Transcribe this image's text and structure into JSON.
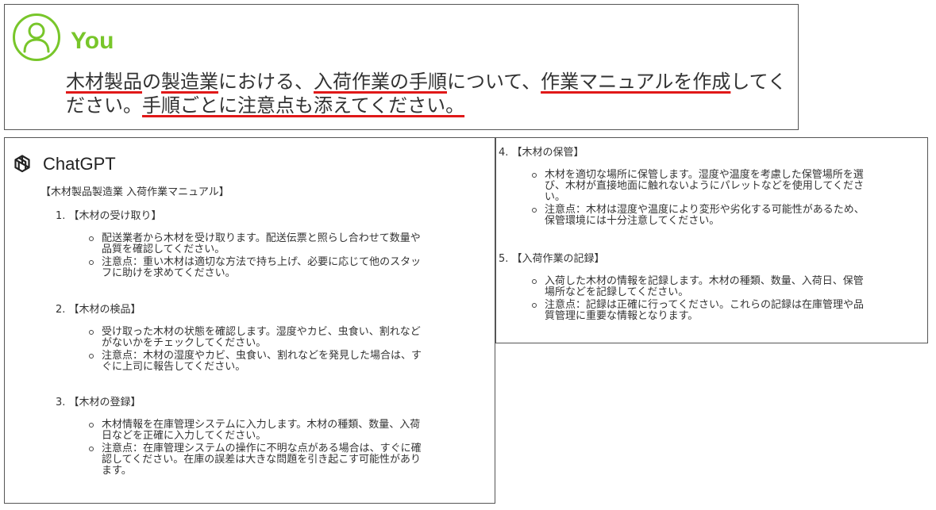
{
  "user": {
    "name": "You",
    "prompt_parts": [
      {
        "text": "木材製品",
        "hl": true
      },
      {
        "text": "の",
        "hl": false
      },
      {
        "text": "製造業",
        "hl": true
      },
      {
        "text": "における、",
        "hl": false
      },
      {
        "text": "入荷作業の手順",
        "hl": true
      },
      {
        "text": "について、",
        "hl": false
      },
      {
        "text": "作業マニュアルを作成",
        "hl": true
      },
      {
        "text": "してください。",
        "hl": false
      },
      {
        "text": "手順ごとに注意点も添えてください。",
        "hl": true
      }
    ]
  },
  "assistant": {
    "name": "ChatGPT",
    "title": "【木材製品製造業 入荷作業マニュアル】",
    "sections": [
      {
        "heading": "1. 【木材の受け取り】",
        "bullets": [
          [
            "配送業者から木材を受け取ります。配送伝票と照らし合わせて数量や",
            "品質を確認してください。"
          ],
          [
            "注意点：重い木材は適切な方法で持ち上げ、必要に応じて他のスタッ",
            "フに助けを求めてください。"
          ]
        ]
      },
      {
        "heading": "2. 【木材の検品】",
        "bullets": [
          [
            "受け取った木材の状態を確認します。湿度やカビ、虫食い、割れなど",
            "がないかをチェックしてください。"
          ],
          [
            "注意点：木材の湿度やカビ、虫食い、割れなどを発見した場合は、す",
            "ぐに上司に報告してください。"
          ]
        ]
      },
      {
        "heading": "3. 【木材の登録】",
        "bullets": [
          [
            "木材情報を在庫管理システムに入力します。木材の種類、数量、入荷",
            "日などを正確に入力してください。"
          ],
          [
            "注意点：在庫管理システムの操作に不明な点がある場合は、すぐに確",
            "認してください。在庫の誤差は大きな問題を引き起こす可能性があり",
            "ます。"
          ]
        ]
      },
      {
        "heading": "4. 【木材の保管】",
        "bullets": [
          [
            "木材を適切な場所に保管します。湿度や温度を考慮した保管場所を選",
            "び、木材が直接地面に触れないようにパレットなどを使用してくださ",
            "い。"
          ],
          [
            "注意点：木材は湿度や温度により変形や劣化する可能性があるため、",
            "保管環境には十分注意してください。"
          ]
        ]
      },
      {
        "heading": "5. 【入荷作業の記録】",
        "bullets": [
          [
            "入荷した木材の情報を記録します。木材の種類、数量、入荷日、保管",
            "場所などを記録してください。"
          ],
          [
            "注意点：記録は正確に行ってください。これらの記録は在庫管理や品",
            "質管理に重要な情報となります。"
          ]
        ]
      }
    ]
  },
  "colors": {
    "accent": "#78c62a",
    "underline": "#e01818",
    "text": "#333333"
  }
}
